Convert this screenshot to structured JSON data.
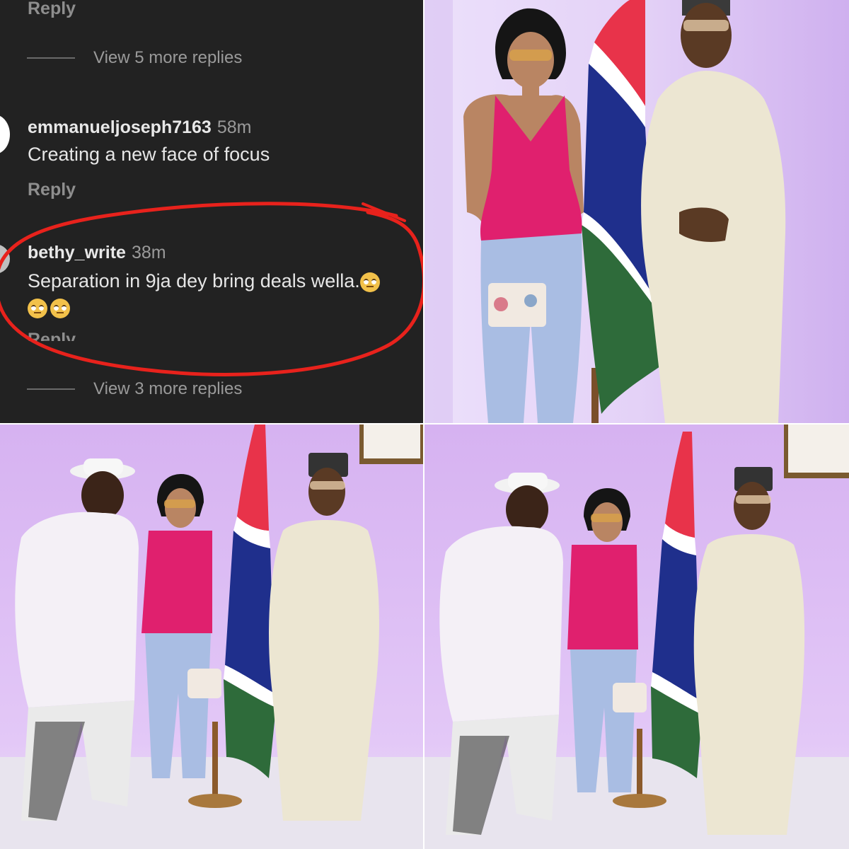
{
  "comments": {
    "top_reply_label": "Reply",
    "view_more_1": "View 5 more replies",
    "comment_1": {
      "username": "emmanueljoseph7163",
      "time": "58m",
      "text": "Creating a new face of focus",
      "reply_label": "Reply"
    },
    "comment_2": {
      "username": "bethy_write",
      "time": "38m",
      "text": "Separation in 9ja dey bring deals wella.",
      "emojis": [
        "face-with-rolling-eyes",
        "face-with-rolling-eyes",
        "face-with-rolling-eyes"
      ],
      "reply_label": "Reply"
    },
    "view_more_2": "View 3 more replies",
    "highlight_color": "#e8221c"
  },
  "photos": {
    "count": 3,
    "scene": "flag-backdrop",
    "flag_colors": [
      "#e8334a",
      "#1f2f8c",
      "#2e6b3a",
      "#ffffff"
    ],
    "wall_color": "#d9b8f0"
  }
}
